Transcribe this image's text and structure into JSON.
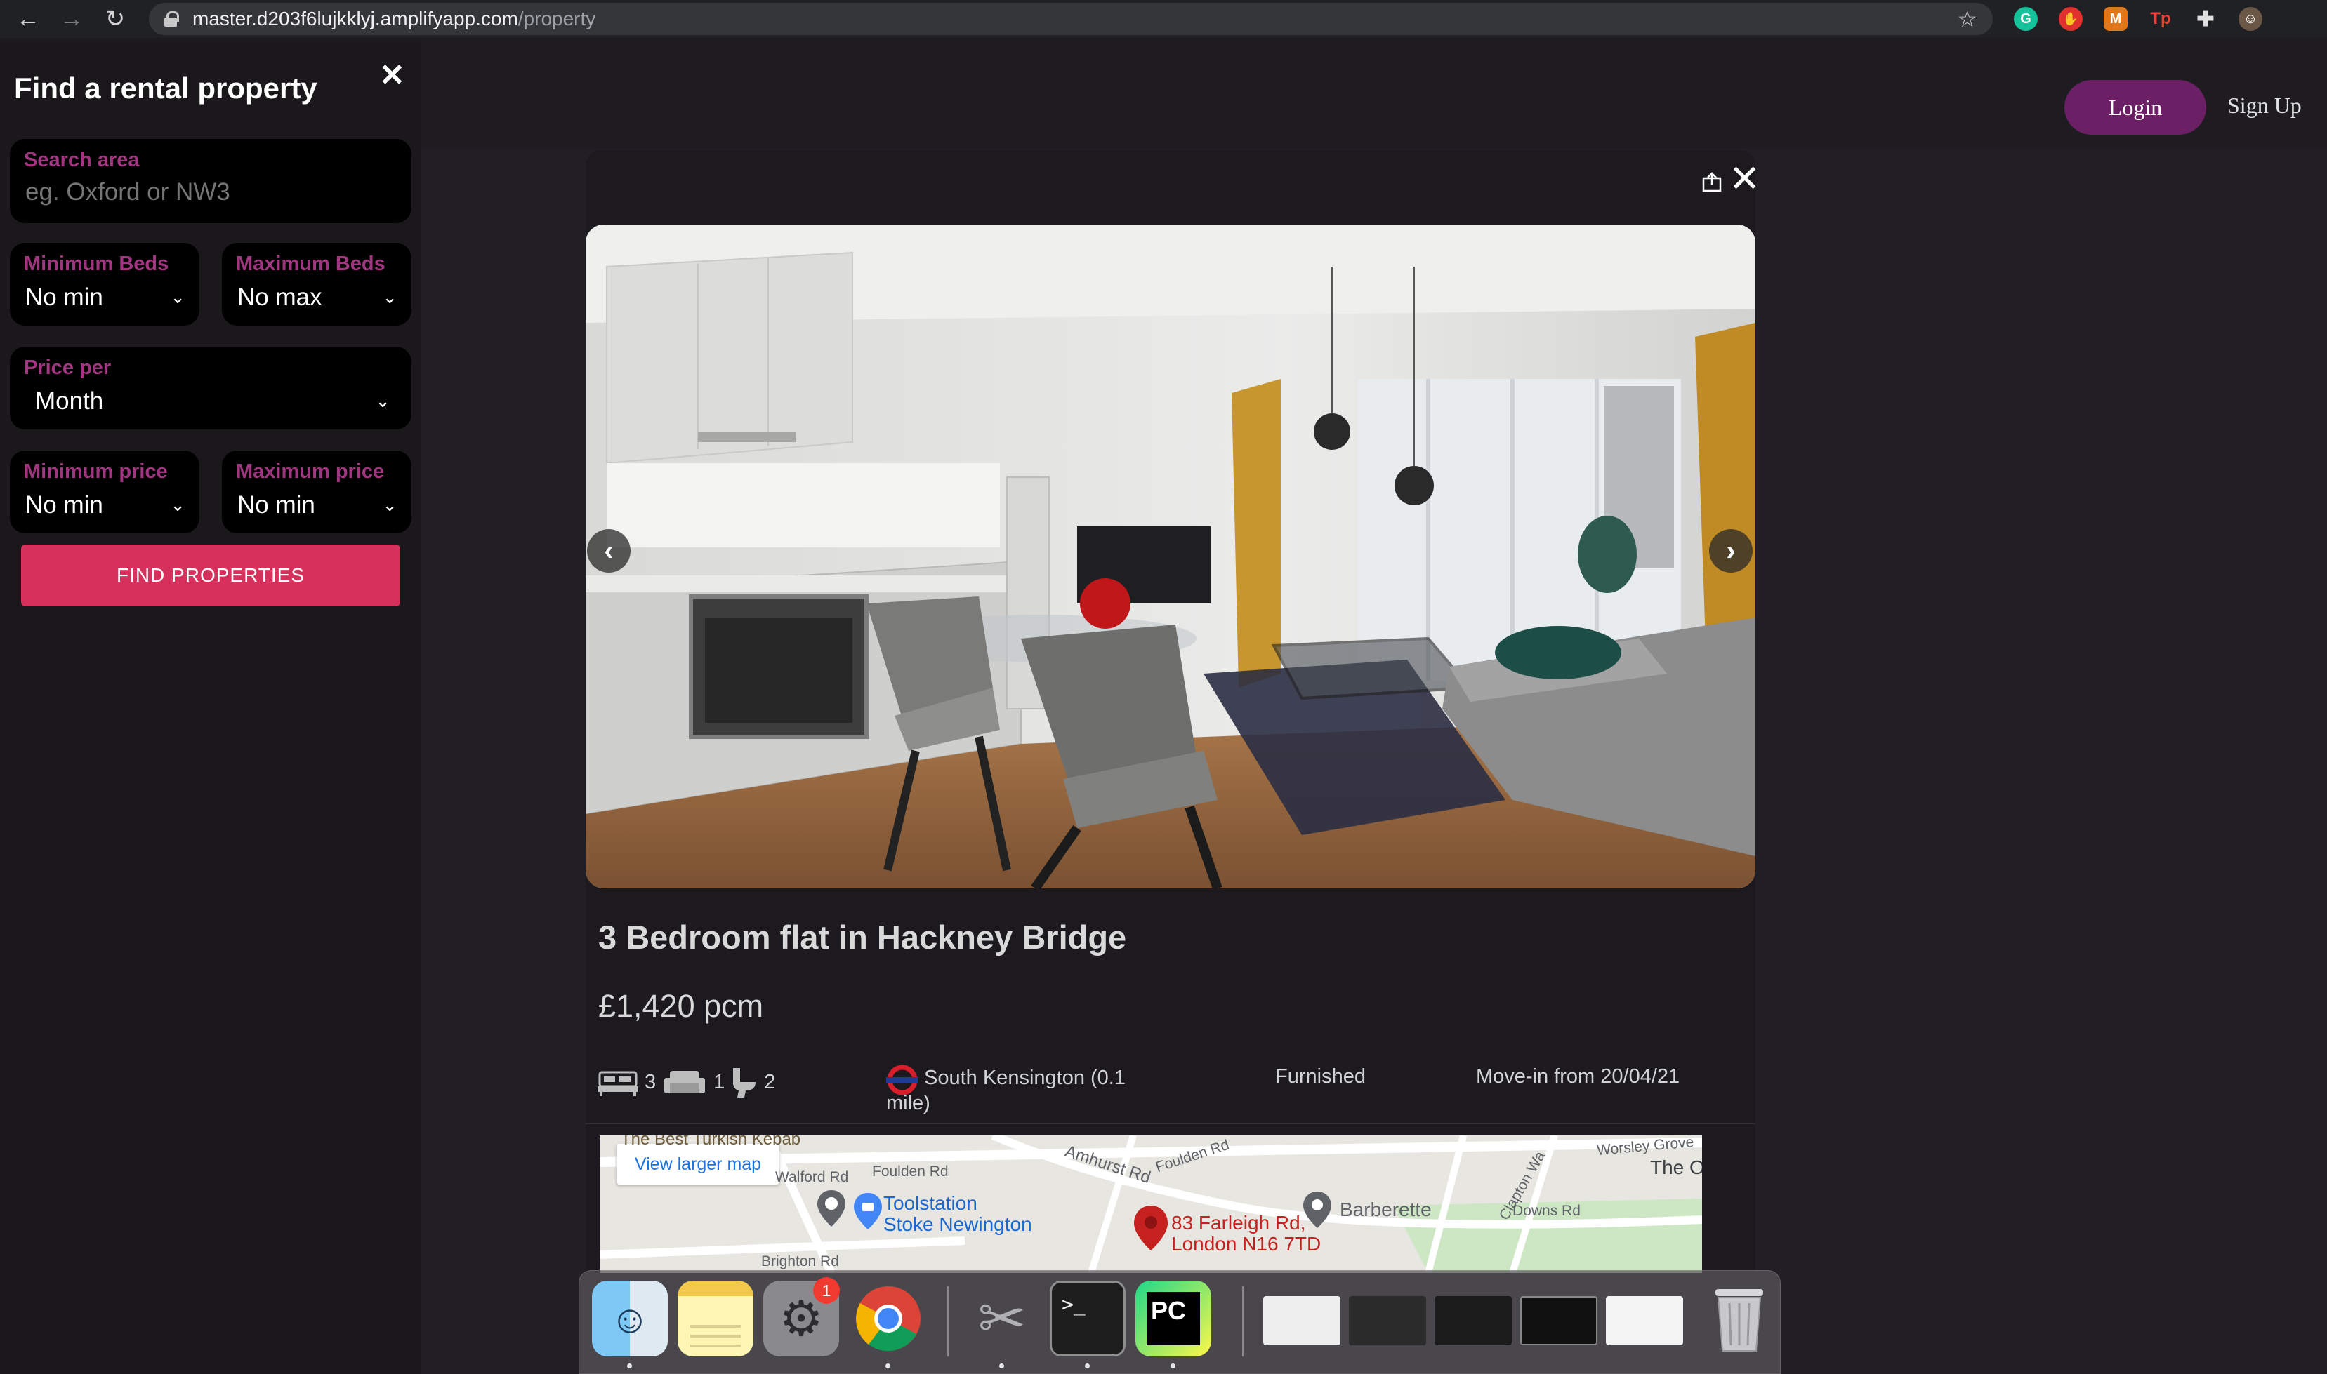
{
  "browser": {
    "url_host": "master.d203f6lujkklyj.amplifyapp.com",
    "url_path": "/property",
    "extensions": [
      {
        "icon": "grammarly-icon",
        "color": "#15c39a",
        "glyph": "G"
      },
      {
        "icon": "adblock-icon",
        "color": "#e0312e",
        "glyph": "✋"
      },
      {
        "icon": "metamask-icon",
        "color": "#e2761b",
        "glyph": "🦊"
      },
      {
        "icon": "tp-icon",
        "color": "#d93025",
        "glyph": "Tp"
      },
      {
        "icon": "puzzle-icon",
        "color": "#202124",
        "glyph": "✚"
      },
      {
        "icon": "avatar-icon",
        "color": "#6a5746",
        "glyph": "☺"
      }
    ]
  },
  "sidebar": {
    "title": "Find a rental property",
    "close_glyph": "✕",
    "search": {
      "label": "Search area",
      "placeholder": "eg. Oxford or NW3"
    },
    "min_beds": {
      "label": "Minimum Beds",
      "value": "No min"
    },
    "max_beds": {
      "label": "Maximum Beds",
      "value": "No max"
    },
    "price_per": {
      "label": "Price per",
      "value": "Month"
    },
    "min_price": {
      "label": "Minimum price",
      "value": "No min"
    },
    "max_price": {
      "label": "Maximum price",
      "value": "No min"
    },
    "find_button": "FIND PROPERTIES"
  },
  "header": {
    "login": "Login",
    "signup": "Sign Up"
  },
  "property": {
    "title": "3 Bedroom flat in Hackney Bridge",
    "price": "£1,420 pcm",
    "bedrooms": "3",
    "receptions": "1",
    "bathrooms": "2",
    "station": "South Kensington (0.1 mile)",
    "station_line1": "South Kensington (0.1",
    "station_line2": "mile)",
    "furnishing": "Furnished",
    "move_in": "Move-in from 20/04/21"
  },
  "map": {
    "view_larger": "View larger map",
    "labels": {
      "turkish_kebab": "The Best Turkish Kebab",
      "amhurst": "Amhurst Rd",
      "foulden_a": "Foulden Rd",
      "foulden_b": "Foulden Rd",
      "walford": "Walford Rd",
      "brighton": "Brighton Rd",
      "downs": "Downs Rd",
      "clapton": "Clapton Wa",
      "worsley": "Worsley Grove",
      "the_o": "The O",
      "toolstation_1": "Toolstation",
      "toolstation_2": "Stoke Newington",
      "addr_1": "83 Farleigh Rd,",
      "addr_2": "London N16 7TD",
      "barberette": "Barberette"
    }
  },
  "dock": {
    "badge_count": "1",
    "apps": [
      "finder-icon",
      "notes-icon",
      "system-preferences-icon",
      "chrome-icon",
      "utilities-icon",
      "terminal-icon",
      "pycharm-icon"
    ],
    "windows": [
      "window-thumb-chrome-1",
      "window-thumb-pycharm",
      "window-thumb-finder",
      "window-thumb-terminal",
      "window-thumb-chrome-2"
    ],
    "trash": "trash-icon"
  },
  "colors": {
    "accent_label": "#a0367f",
    "find_button": "#d6305d",
    "login_button": "#6b1f64",
    "map_pin": "#c5221f"
  }
}
